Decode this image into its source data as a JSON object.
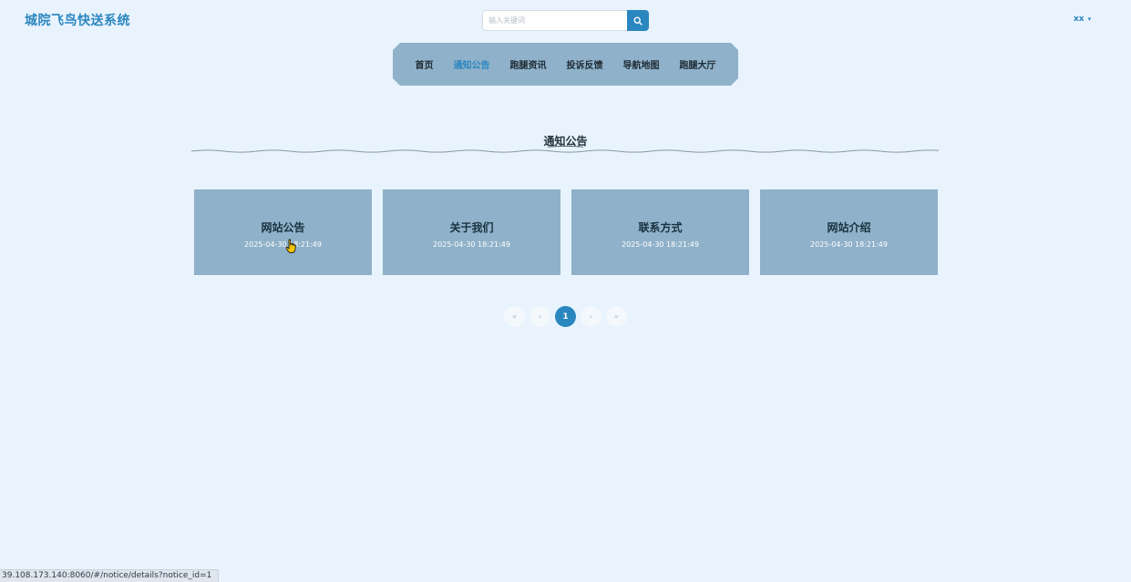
{
  "app": {
    "title": "城院飞鸟快送系统"
  },
  "search": {
    "placeholder": "输入关键词",
    "icon": "search-icon"
  },
  "user": {
    "name": "xx",
    "caret": "▾"
  },
  "nav": {
    "items": [
      {
        "label": "首页",
        "active": false
      },
      {
        "label": "通知公告",
        "active": true
      },
      {
        "label": "跑腿资讯",
        "active": false
      },
      {
        "label": "投诉反馈",
        "active": false
      },
      {
        "label": "导航地图",
        "active": false
      },
      {
        "label": "跑腿大厅",
        "active": false
      }
    ]
  },
  "section": {
    "title": "通知公告"
  },
  "notices": [
    {
      "title": "网站公告",
      "date": "2025-04-30 18:21:49"
    },
    {
      "title": "关于我们",
      "date": "2025-04-30 18:21:49"
    },
    {
      "title": "联系方式",
      "date": "2025-04-30 18:21:49"
    },
    {
      "title": "网站介绍",
      "date": "2025-04-30 18:21:49"
    }
  ],
  "pagination": {
    "first": "«",
    "prev": "‹",
    "current": "1",
    "next": "›",
    "last": "»"
  },
  "status_bar": {
    "url": "39.108.173.140:8060/#/notice/details?notice_id=1"
  },
  "colors": {
    "accent": "#2a86bf",
    "nav_bg": "#8fb1c9",
    "page_bg": "#e8f3fd"
  }
}
